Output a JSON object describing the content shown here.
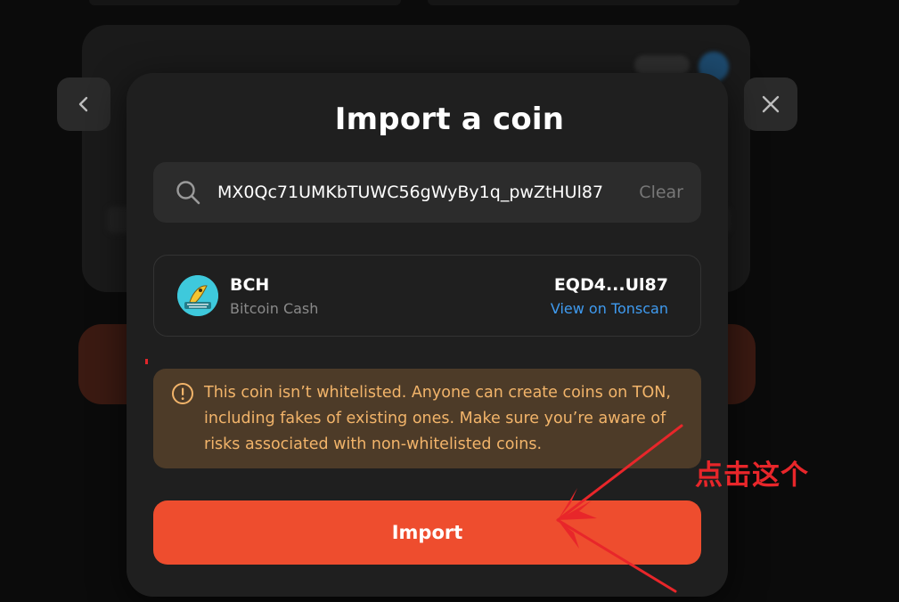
{
  "modal": {
    "title": "Import a coin",
    "search": {
      "value": "MX0Qc71UMKbTUWC56gWyBy1q_pwZtHUl87",
      "clear_label": "Clear"
    },
    "coin": {
      "symbol": "BCH",
      "name": "Bitcoin Cash",
      "address_short": "EQD4...Ul87",
      "link_label": "View on Tonscan",
      "logo_icon": "banana-tool-logo"
    },
    "warning": {
      "text": "This coin isn’t whitelisted. Anyone can create coins on TON, including fakes of existing ones. Make sure you’re aware of risks associated with non-whitelisted coins.",
      "color": "#f2b46a"
    },
    "import_label": "Import",
    "accent_color": "#ee4d2e",
    "link_color": "#3f9bf0"
  },
  "nav": {
    "back_icon": "chevron-left-icon",
    "close_icon": "close-icon"
  },
  "annotation": {
    "text": "点击这个",
    "color": "#e8262a"
  }
}
